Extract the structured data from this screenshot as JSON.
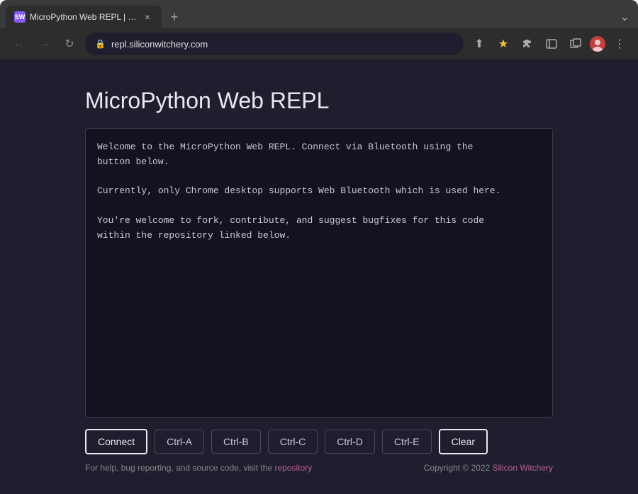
{
  "browser": {
    "tab": {
      "favicon_text": "SW",
      "title": "MicroPython Web REPL | Silico…",
      "close_label": "×"
    },
    "new_tab_label": "+",
    "chevron_label": "⌄",
    "address": "repl.siliconwitchery.com",
    "nav": {
      "back_label": "←",
      "forward_label": "→",
      "reload_label": "↻"
    },
    "toolbar": {
      "share_label": "⬆",
      "star_label": "★",
      "puzzle_label": "🧩",
      "sidebar_label": "⧉",
      "window_label": "⬜",
      "menu_label": "⋮"
    }
  },
  "page": {
    "title": "MicroPython Web REPL",
    "terminal_lines": [
      "Welcome to the MicroPython Web REPL. Connect via Bluetooth using the",
      "button below.",
      "",
      "Currently, only Chrome desktop supports Web Bluetooth which is used here.",
      "",
      "You're welcome to fork, contribute, and suggest bugfixes for this code",
      "within the repository linked below."
    ]
  },
  "buttons": {
    "connect": "Connect",
    "ctrl_a": "Ctrl-A",
    "ctrl_b": "Ctrl-B",
    "ctrl_c": "Ctrl-C",
    "ctrl_d": "Ctrl-D",
    "ctrl_e": "Ctrl-E",
    "clear": "Clear"
  },
  "footer": {
    "left_text": "For help, bug reporting, and source code, visit the ",
    "left_link_text": "repository",
    "right_text": "Copyright © 2022 ",
    "right_link_text": "Silicon Witchery"
  }
}
